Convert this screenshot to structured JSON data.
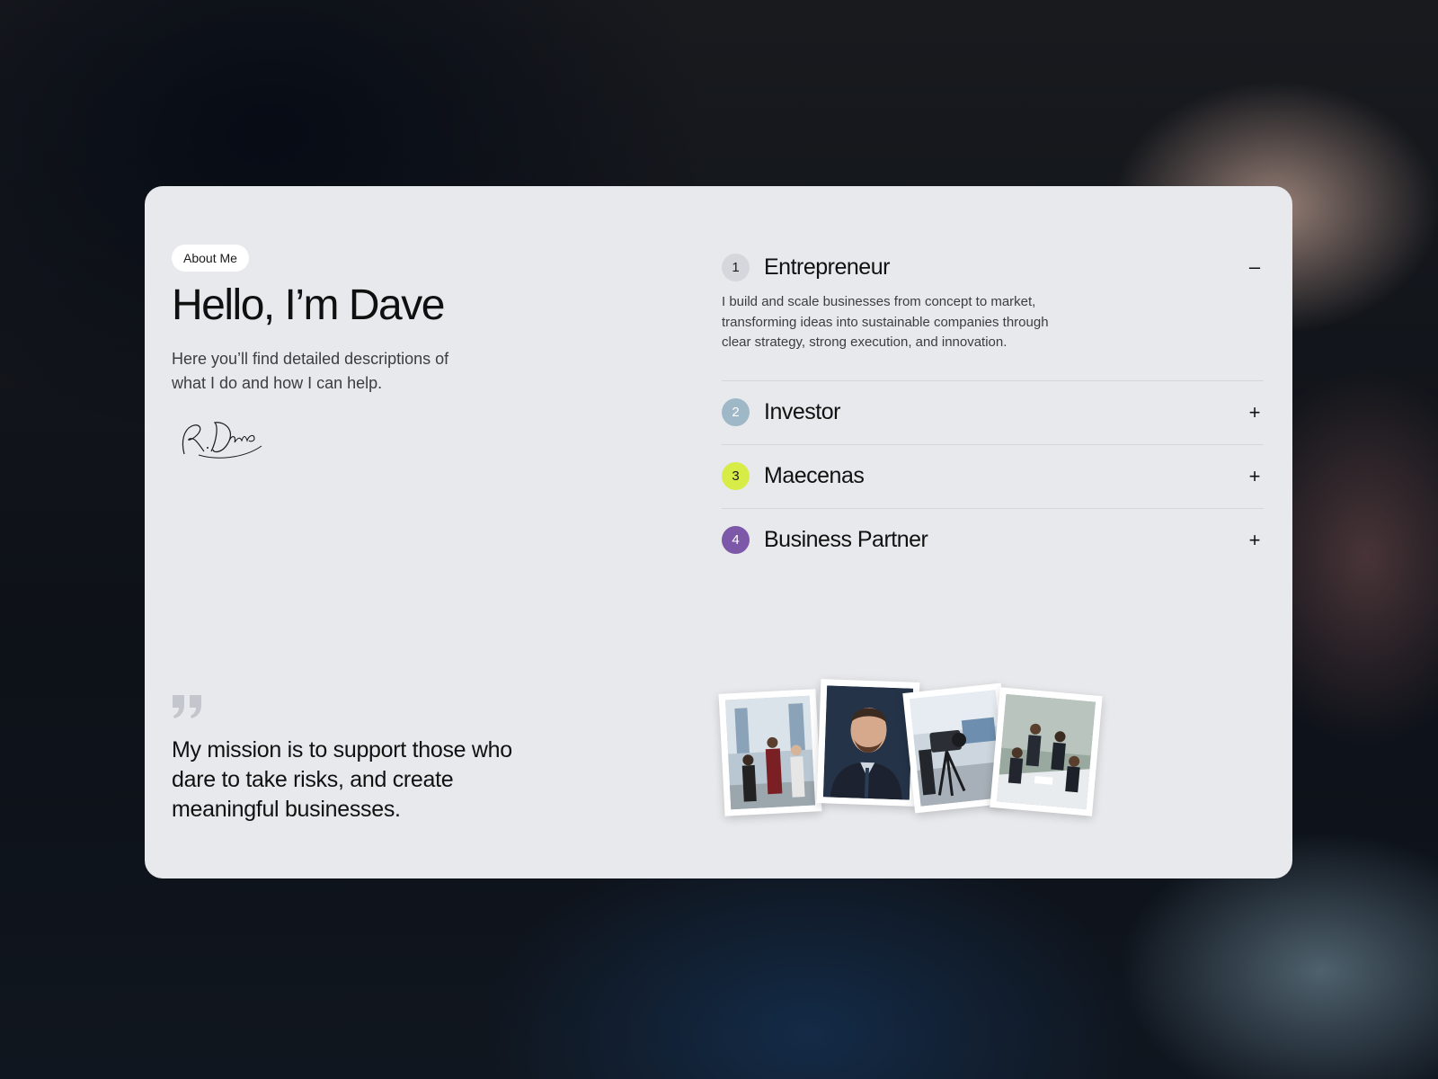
{
  "about": {
    "badge": "About Me",
    "headline": "Hello, I’m Dave",
    "lead": "Here you’ll find detailed descriptions of what I do and how I can help.",
    "signature_text": "R.Dave"
  },
  "mission": {
    "text": "My mission is to support those who dare to take risks, and create meaningful businesses."
  },
  "accordion": {
    "items": [
      {
        "number": "1",
        "title": "Entrepreneur",
        "toggle": "–",
        "badge_color": "#d5d7dc",
        "number_color": "#1a1a1a",
        "expanded": true,
        "description": "I build and scale businesses from concept to market, transforming ideas into sustainable companies through clear strategy, strong execution, and innovation."
      },
      {
        "number": "2",
        "title": "Investor",
        "toggle": "+",
        "badge_color": "#9fb8c7",
        "number_color": "#ffffff",
        "expanded": false
      },
      {
        "number": "3",
        "title": "Maecenas",
        "toggle": "+",
        "badge_color": "#d8ec47",
        "number_color": "#1a1a1a",
        "expanded": false
      },
      {
        "number": "4",
        "title": "Business Partner",
        "toggle": "+",
        "badge_color": "#7e58a8",
        "number_color": "#ffffff",
        "expanded": false
      }
    ]
  },
  "photos": [
    {
      "subject": "business-team-photo"
    },
    {
      "subject": "portrait-photo"
    },
    {
      "subject": "camera-studio-photo"
    },
    {
      "subject": "meeting-photo"
    }
  ]
}
